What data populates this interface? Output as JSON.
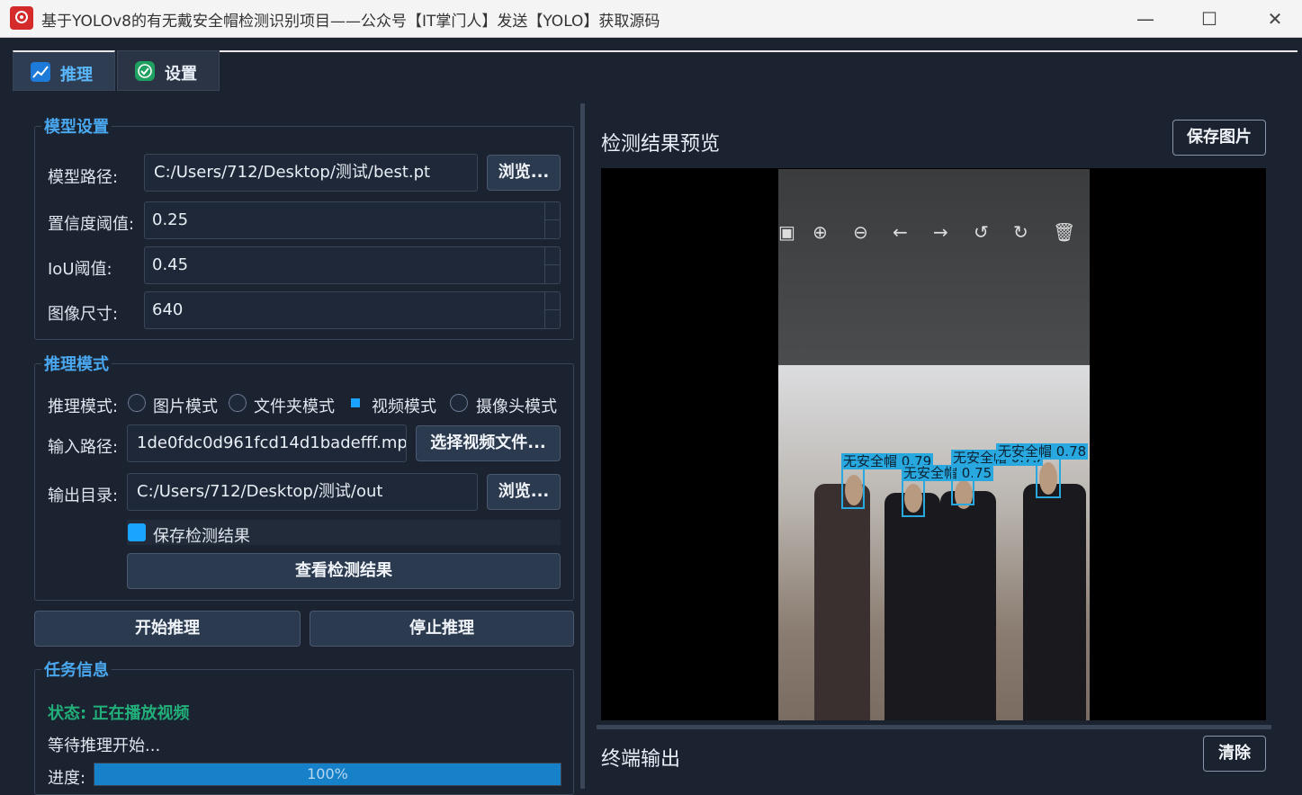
{
  "window": {
    "title": "基于YOLOv8的有无戴安全帽检测识别项目——公众号【IT掌门人】发送【YOLO】获取源码",
    "minimize_icon": "minimize-icon",
    "maximize_icon": "maximize-icon",
    "close_icon": "close-icon"
  },
  "tabs": [
    {
      "label": "推理",
      "icon": "chart-icon",
      "active": true
    },
    {
      "label": "设置",
      "icon": "checkmark-icon",
      "active": false
    }
  ],
  "model_settings": {
    "title": "模型设置",
    "model_path_label": "模型路径:",
    "model_path_value": "C:/Users/712/Desktop/测试/best.pt",
    "browse_label": "浏览...",
    "conf_label": "置信度阈值:",
    "conf_value": "0.25",
    "iou_label": "IoU阈值:",
    "iou_value": "0.45",
    "imgsz_label": "图像尺寸:",
    "imgsz_value": "640"
  },
  "inference_mode": {
    "title": "推理模式",
    "mode_label": "推理模式:",
    "modes": [
      "图片模式",
      "文件夹模式",
      "视频模式",
      "摄像头模式"
    ],
    "selected_mode": "视频模式",
    "input_label": "输入路径:",
    "input_value": "1de0fdc0d961fcd14d1badefff.mp4",
    "select_video_label": "选择视频文件...",
    "output_label": "输出目录:",
    "output_value": "C:/Users/712/Desktop/测试/out",
    "output_browse_label": "浏览...",
    "save_results_label": "保存检测结果",
    "save_results_checked": true,
    "view_results_label": "查看检测结果"
  },
  "actions": {
    "start_label": "开始推理",
    "stop_label": "停止推理"
  },
  "task_info": {
    "title": "任务信息",
    "status": "状态: 正在播放视频",
    "message": "等待推理开始...",
    "progress_label": "进度:",
    "progress_value": 100,
    "progress_text": "100%"
  },
  "preview": {
    "title": "检测结果预览",
    "save_image_label": "保存图片",
    "detections": [
      {
        "label": "无安全帽 0.79"
      },
      {
        "label": "无安全帽 0.75"
      },
      {
        "label": "无安全帽 0.75"
      },
      {
        "label": "无安全帽 0.78"
      }
    ]
  },
  "terminal": {
    "title": "终端输出",
    "clear_label": "清除"
  },
  "colors": {
    "accent": "#1aa3ff",
    "status_green": "#22b07a",
    "box_blue": "#29a8e0",
    "background": "#1b2230"
  }
}
